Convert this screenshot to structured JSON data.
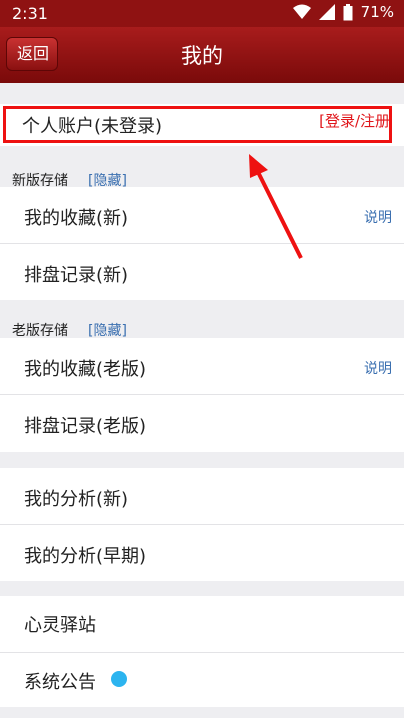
{
  "status_bar": {
    "time": "2:31",
    "battery": "71%",
    "icons": [
      "wifi-icon",
      "signal-icon",
      "battery-icon"
    ]
  },
  "nav": {
    "back_label": "返回",
    "title": "我的"
  },
  "account": {
    "label": "个人账户(未登录)",
    "login_link": "[登录/注册"
  },
  "new_storage": {
    "title": "新版存储",
    "hide_label": "[隐藏]",
    "items": [
      {
        "label": "我的收藏(新)",
        "note": "说明"
      },
      {
        "label": "排盘记录(新)"
      }
    ]
  },
  "old_storage": {
    "title": "老版存储",
    "hide_label": "[隐藏]",
    "items": [
      {
        "label": "我的收藏(老版)",
        "note": "说明"
      },
      {
        "label": "排盘记录(老版)"
      }
    ]
  },
  "analysis": {
    "items": [
      {
        "label": "我的分析(新)"
      },
      {
        "label": "我的分析(早期)"
      }
    ]
  },
  "misc": {
    "items": [
      {
        "label": "心灵驿站"
      },
      {
        "label": "系统公告"
      }
    ]
  },
  "colors": {
    "nav_red": "#8f1212",
    "login_red": "#e0161b",
    "link_blue": "#3a6fb0",
    "badge_blue": "#2cb4ef",
    "annotation_red": "#ee1111"
  }
}
